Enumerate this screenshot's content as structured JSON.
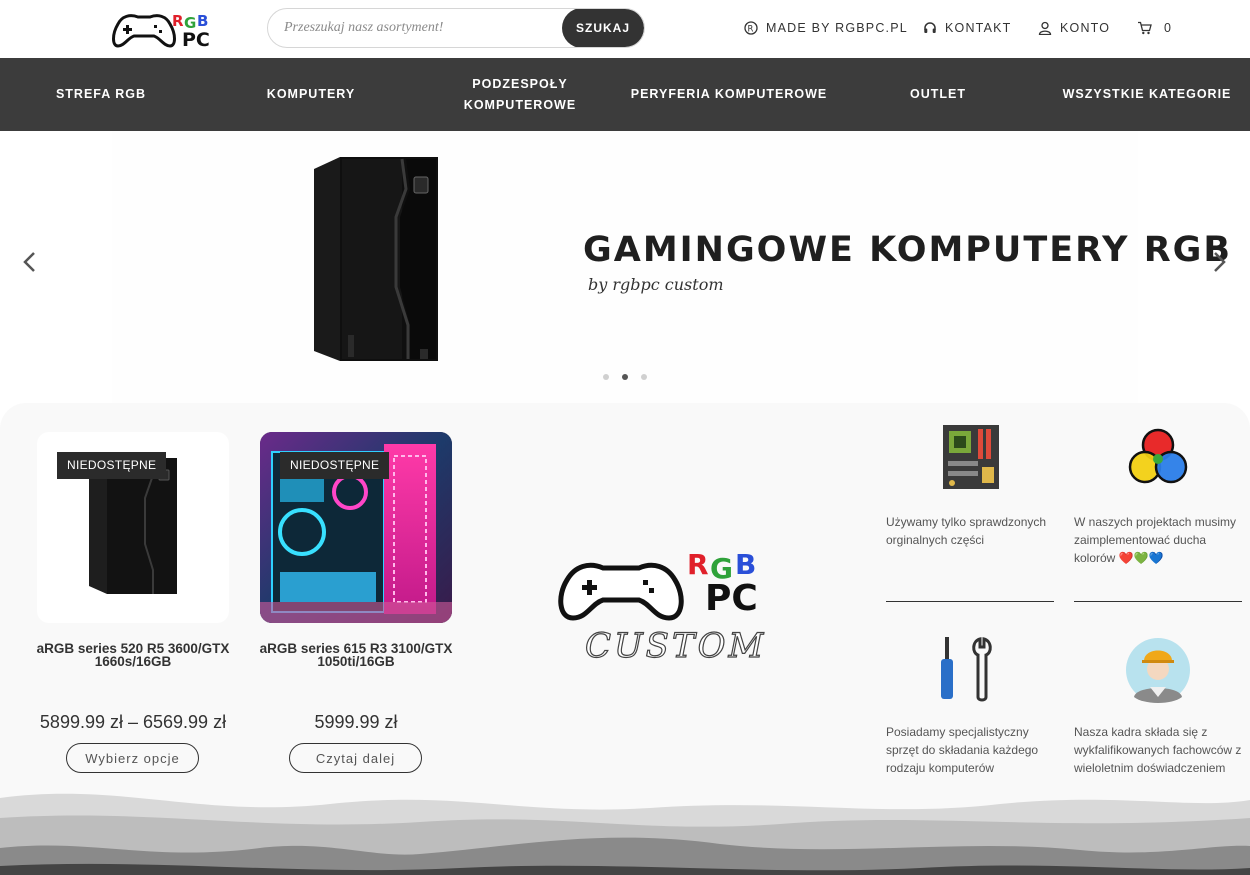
{
  "header": {
    "logo_alt": "RGB PC",
    "search": {
      "placeholder": "Przeszukaj nasz asortyment!",
      "value": "",
      "button_label": "SZUKAJ"
    },
    "links": [
      {
        "label": "MADE BY RGBPC.PL",
        "icon": "registered-icon"
      },
      {
        "label": "KONTAKT",
        "icon": "headset-icon"
      },
      {
        "label": "KONTO",
        "icon": "user-icon"
      },
      {
        "label": "0",
        "icon": "cart-icon"
      }
    ]
  },
  "nav": {
    "items": [
      {
        "label": "STREFA RGB"
      },
      {
        "label": "KOMPUTERY"
      },
      {
        "label": "PODZESPOŁY KOMPUTEROWE"
      },
      {
        "label": "PERYFERIA KOMPUTEROWE"
      },
      {
        "label": "OUTLET"
      },
      {
        "label": "WSZYSTKIE KATEGORIE"
      }
    ]
  },
  "slider": {
    "title": "GAMINGOWE KOMPUTERY RGB",
    "subtitle": "by rgbpc custom",
    "slide_count": 3,
    "active_slide": 2
  },
  "products": [
    {
      "badge": "NIEDOSTĘPNE",
      "name": "aRGB series 520 R5 3600/GTX 1660s/16GB",
      "price": "5899.99 zł – 6569.99 zł",
      "button": "Wybierz opcje"
    },
    {
      "badge": "NIEDOSTĘPNE",
      "name": "aRGB series 615 R3 3100/GTX 1050ti/16GB",
      "price": "5999.99 zł",
      "button": "Czytaj dalej"
    }
  ],
  "brand_logo": {
    "text": "CUSTOM"
  },
  "features": [
    {
      "icon": "motherboard-icon",
      "text": "Używamy tylko sprawdzonych orginalnych części"
    },
    {
      "icon": "color-circles-icon",
      "text": "W naszych projektach musimy zaimplementować ducha kolorów ❤️💚💙"
    },
    {
      "icon": "tools-icon",
      "text": "Posiadamy specjalistyczny sprzęt do składania każdego rodzaju komputerów"
    },
    {
      "icon": "worker-icon",
      "text": "Nasza kadra składa się z wykfalifikowanych fachowców z wieloletnim doświadczeniem"
    }
  ],
  "colors": {
    "nav_bg": "#3c3c3c",
    "button_dark": "#333333",
    "rgb_red": "#e0202a",
    "rgb_green": "#2fa23a",
    "rgb_blue": "#2a4fd8"
  }
}
